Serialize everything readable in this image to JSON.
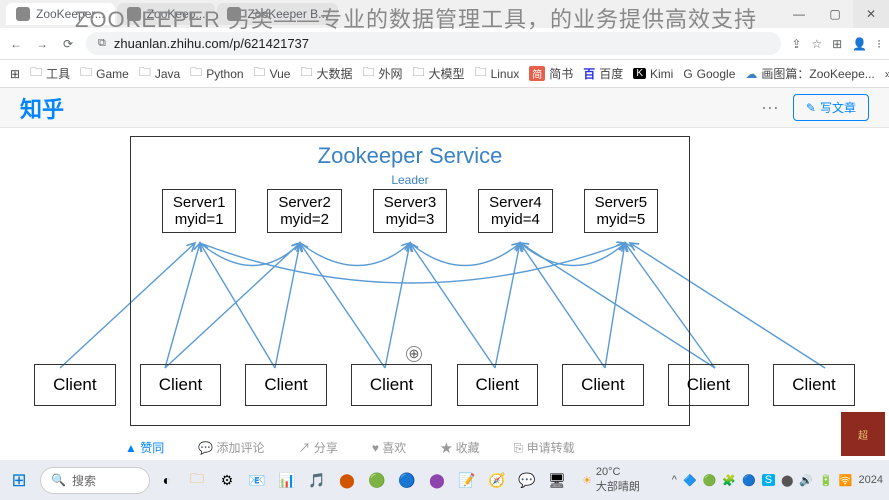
{
  "overlay": "ZOOKEEPER 另类——专业的数据管理工具，的业务提供高效支持",
  "window": {
    "minimize": "—",
    "maximize": "▢",
    "close": "✕"
  },
  "tabs": [
    {
      "label": "ZooKeeper...",
      "active": true
    },
    {
      "label": "ZooKeep...",
      "active": false
    },
    {
      "label": "ZooKeeper B...",
      "active": false
    }
  ],
  "nav": {
    "back": "←",
    "forward": "→",
    "reload": "⟳"
  },
  "url": {
    "lock": "⧉",
    "text": "zhuanlan.zhihu.com/p/621421737"
  },
  "addr_icons": {
    "share": "⇪",
    "star": "☆",
    "ext": "⊞",
    "menu": "⁝",
    "avatar": "👤"
  },
  "bookmarks": [
    {
      "icon": "⊞",
      "label": ""
    },
    {
      "icon": "🗀",
      "label": "工具"
    },
    {
      "icon": "🗀",
      "label": "Game"
    },
    {
      "icon": "🗀",
      "label": "Java"
    },
    {
      "icon": "🗀",
      "label": "Python"
    },
    {
      "icon": "🗀",
      "label": "Vue"
    },
    {
      "icon": "🗀",
      "label": "大数据"
    },
    {
      "icon": "🗀",
      "label": "外网"
    },
    {
      "icon": "🗀",
      "label": "大模型"
    },
    {
      "icon": "🗀",
      "label": "Linux"
    },
    {
      "icon": "简",
      "label": "简书"
    },
    {
      "icon": "百",
      "label": "百度"
    },
    {
      "icon": "K",
      "label": "Kimi"
    },
    {
      "icon": "G",
      "label": "Google"
    },
    {
      "icon": "☁",
      "label": "画图篇：ZooKeepe..."
    }
  ],
  "bookmarks_more": "»",
  "zhihu": {
    "logo": "知乎",
    "dots": "···",
    "write_icon": "✎",
    "write": "写文章"
  },
  "diagram": {
    "title": "Zookeeper Service",
    "leader": "Leader",
    "servers": [
      {
        "name": "Server1",
        "id": "myid=1"
      },
      {
        "name": "Server2",
        "id": "myid=2"
      },
      {
        "name": "Server3",
        "id": "myid=3"
      },
      {
        "name": "Server4",
        "id": "myid=4"
      },
      {
        "name": "Server5",
        "id": "myid=5"
      }
    ],
    "clients": [
      "Client",
      "Client",
      "Client",
      "Client",
      "Client",
      "Client",
      "Client",
      "Client"
    ],
    "zoom": "⊕"
  },
  "actions": {
    "agree": "▲ 赞同",
    "comment": "💬 添加评论",
    "share": "↗ 分享",
    "like": "♥ 喜欢",
    "collect": "★ 收藏",
    "repost": "⎘ 申请转载"
  },
  "taskbar": {
    "start": "⊞",
    "search_icon": "🔍",
    "search": "搜索",
    "apps": [
      "◐",
      "🗀",
      "⚙",
      "📧",
      "📊",
      "🎵",
      "⬤",
      "🟢",
      "🔵",
      "⬤",
      "📝",
      "🧭",
      "💬",
      "🖥"
    ],
    "weather": {
      "icon": "☀",
      "temp": "20°C",
      "desc": "大部晴朗"
    },
    "tray": [
      "^",
      "🔷",
      "🟢",
      "🧩",
      "🔵",
      "S",
      "⬤",
      "🔊",
      "🔋",
      "🛜"
    ],
    "year": "2024"
  },
  "seal": "超"
}
